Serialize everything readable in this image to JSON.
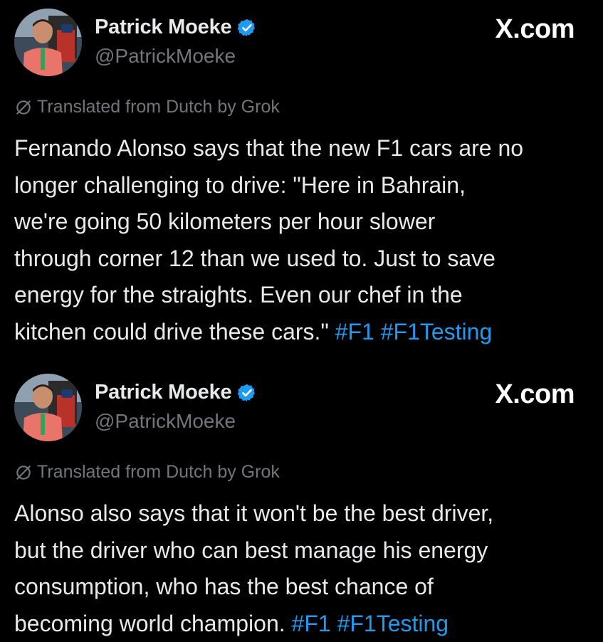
{
  "colors": {
    "background": "#000000",
    "text": "#e7e9ea",
    "muted": "#71767b",
    "link": "#1d9bf0",
    "verified_badge": "#1d9bf0"
  },
  "tweets": [
    {
      "author": {
        "display_name": "Patrick Moeke",
        "handle": "@PatrickMoeke",
        "verified_icon": "verified-badge-icon",
        "avatar": "avatar-photo"
      },
      "brand": "X.com",
      "translated_label": "Translated from Dutch by Grok",
      "translated_icon": "grok-icon",
      "text_lines": [
        "Fernando Alonso says that the new F1 cars are no",
        "longer challenging to drive: \"Here in Bahrain,",
        "we're going 50 kilometers per hour slower",
        "through corner 12 than we used to. Just to save",
        "energy for the straights. Even our chef in the",
        "kitchen could drive these cars.\" "
      ],
      "hashtags": [
        "#F1",
        "#F1Testing"
      ]
    },
    {
      "author": {
        "display_name": "Patrick Moeke",
        "handle": "@PatrickMoeke",
        "verified_icon": "verified-badge-icon",
        "avatar": "avatar-photo"
      },
      "brand": "X.com",
      "translated_label": "Translated from Dutch by Grok",
      "translated_icon": "grok-icon",
      "text_lines": [
        "Alonso also says that it won't be the best driver,",
        "but the driver who can best manage his energy",
        "consumption, who has the best chance of",
        "becoming world champion. "
      ],
      "hashtags": [
        "#F1",
        "#F1Testing"
      ]
    }
  ]
}
